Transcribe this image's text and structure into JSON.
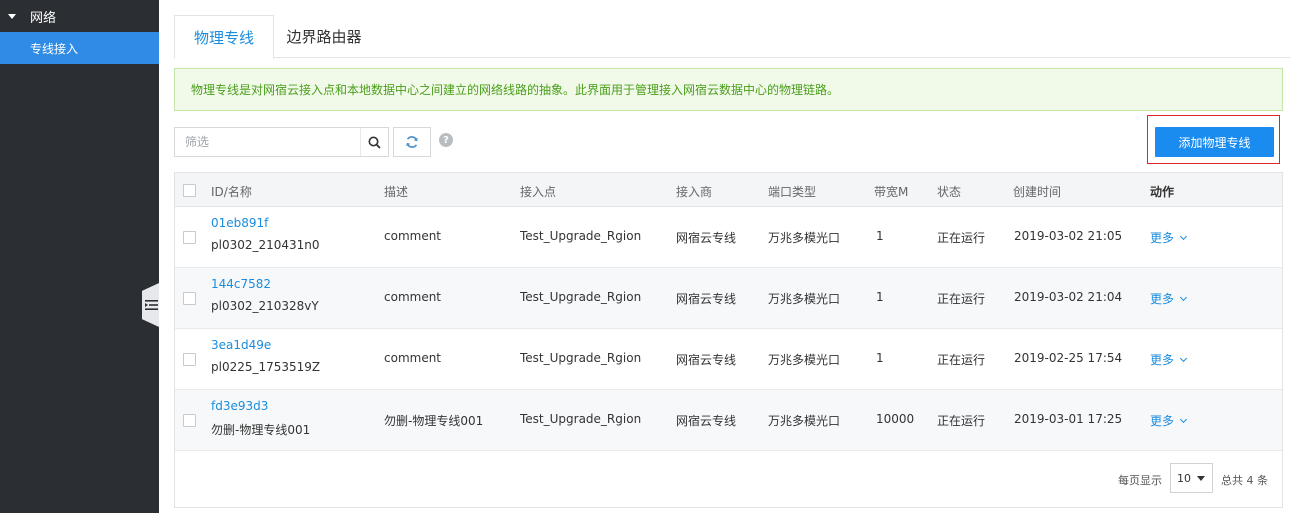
{
  "sidebar": {
    "group_label": "网络",
    "items": [
      {
        "label": "专线接入",
        "active": true
      }
    ]
  },
  "tabs": [
    {
      "label": "物理专线",
      "active": true
    },
    {
      "label": "边界路由器",
      "active": false
    }
  ],
  "notice": "物理专线是对网宿云接入点和本地数据中心之间建立的网络线路的抽象。此界面用于管理接入网宿云数据中心的物理链路。",
  "toolbar": {
    "filter_placeholder": "筛选",
    "add_button": "添加物理专线",
    "help_glyph": "?"
  },
  "table": {
    "headers": [
      "ID/名称",
      "描述",
      "接入点",
      "接入商",
      "端口类型",
      "带宽M",
      "状态",
      "创建时间",
      "动作"
    ],
    "rows": [
      {
        "id": "01eb891f",
        "name": "pl0302_210431n0",
        "desc": "comment",
        "access_point": "Test_Upgrade_Rgion",
        "provider": "网宿云专线",
        "port_type": "万兆多模光口",
        "bandwidth": "1",
        "status": "正在运行",
        "created": "2019-03-02 21:05",
        "action": "更多"
      },
      {
        "id": "144c7582",
        "name": "pl0302_210328vY",
        "desc": "comment",
        "access_point": "Test_Upgrade_Rgion",
        "provider": "网宿云专线",
        "port_type": "万兆多模光口",
        "bandwidth": "1",
        "status": "正在运行",
        "created": "2019-03-02 21:04",
        "action": "更多"
      },
      {
        "id": "3ea1d49e",
        "name": "pl0225_1753519Z",
        "desc": "comment",
        "access_point": "Test_Upgrade_Rgion",
        "provider": "网宿云专线",
        "port_type": "万兆多模光口",
        "bandwidth": "1",
        "status": "正在运行",
        "created": "2019-02-25 17:54",
        "action": "更多"
      },
      {
        "id": "fd3e93d3",
        "name": "勿删-物理专线001",
        "desc": "勿删-物理专线001",
        "access_point": "Test_Upgrade_Rgion",
        "provider": "网宿云专线",
        "port_type": "万兆多模光口",
        "bandwidth": "10000",
        "status": "正在运行",
        "created": "2019-03-01 17:25",
        "action": "更多"
      }
    ]
  },
  "pagination": {
    "per_page_label": "每页显示",
    "per_page_value": "10",
    "total_label": "总共 4 条"
  },
  "colors": {
    "accent": "#1a8cf0",
    "sidebar_bg": "#2b2e33",
    "notice_text": "#4a9e1c"
  }
}
